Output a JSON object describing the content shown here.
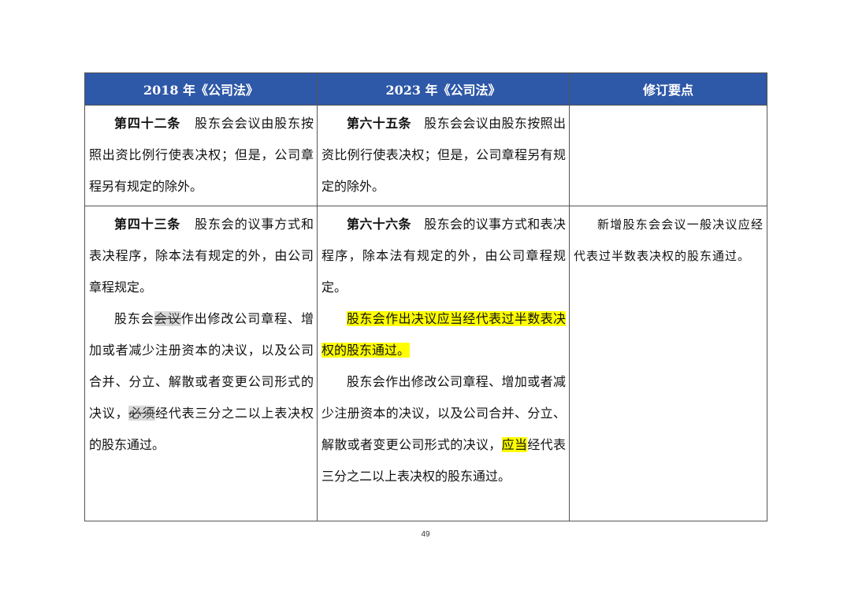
{
  "table": {
    "headers": [
      "2018 年《公司法》",
      "2023 年《公司法》",
      "修订要点"
    ],
    "row1": {
      "old": {
        "article": "第四十二条",
        "text": "股东会会议由股东按照出资比例行使表决权；但是，公司章程另有规定的除外。"
      },
      "new": {
        "article": "第六十五条",
        "text": "股东会会议由股东按照出资比例行使表决权；但是，公司章程另有规定的除外。"
      },
      "note": ""
    },
    "row2": {
      "old": {
        "article": "第四十三条",
        "text1": "股东会的议事方式和表决程序，除本法有规定的外，由公司章程规定。",
        "p2_a": "股东会",
        "p2_del1": "会议",
        "p2_b": "作出修改公司章程、增加或者减少注册资本的决议，以及公司合并、分立、解散或者变更公司形式的决议，",
        "p2_del2": "必须",
        "p2_c": "经代表三分之二以上表决权的股东通过。"
      },
      "new": {
        "article": "第六十六条",
        "text1": "股东会的议事方式和表决程序，除本法有规定的外，由公司章程规定。",
        "p2_hl": "股东会作出决议应当经代表过半数表决权的股东通过。",
        "p3_a": "股东会作出修改公司章程、增加或者减少注册资本的决议，以及公司合并、分立、解散或者变更公司形式的决议，",
        "p3_hl": "应当",
        "p3_b": "经代表三分之二以上表决权的股东通过。"
      },
      "note": "新增股东会会议一般决议应经代表过半数表决权的股东通过。"
    }
  },
  "footer": {
    "page_number": "49"
  },
  "colors": {
    "header_bg": "#2e58a8",
    "highlight": "#ffff00"
  }
}
